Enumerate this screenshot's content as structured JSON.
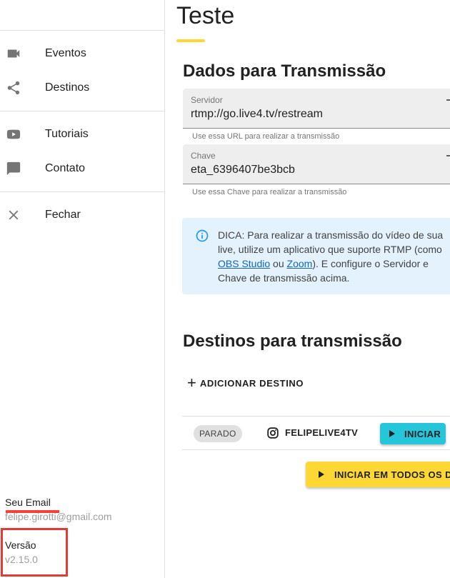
{
  "sidebar": {
    "items": [
      {
        "label": "Eventos",
        "icon": "videocam-icon"
      },
      {
        "label": "Destinos",
        "icon": "share-icon"
      },
      {
        "label": "Tutoriais",
        "icon": "youtube-icon"
      },
      {
        "label": "Contato",
        "icon": "chat-bubble-icon"
      },
      {
        "label": "Fechar",
        "icon": "close-icon"
      }
    ],
    "account": {
      "email_label": "Seu Email",
      "email_value": "felipe.girotti@gmail.com",
      "version_label": "Versão",
      "version_value": "v2.15.0"
    }
  },
  "main": {
    "title": "Teste",
    "stream_section_title": "Dados para Transmissão",
    "server_field": {
      "label": "Servidor",
      "value": "rtmp://go.live4.tv/restream",
      "hint": "Use essa URL para realizar a transmissão"
    },
    "key_field": {
      "label": "Chave",
      "value": "eta_6396407be3bcb",
      "hint": "Use essa Chave para realizar a transmissão"
    },
    "tip": {
      "text_before": "DICA: Para realizar a transmissão do vídeo de sua live, utilize um aplicativo que suporte RTMP (como ",
      "link1": "OBS Studio",
      "text_between": " ou ",
      "link2": "Zoom",
      "text_after": "). E configure o Servidor e Chave de transmissão acima."
    },
    "destinations_section_title": "Destinos para transmissão",
    "add_destination_label": "ADICIONAR DESTINO",
    "destinations": [
      {
        "status": "PARADO",
        "platform_icon": "instagram-icon",
        "name": "FELIPELIVE4TV",
        "start_label": "INICIAR"
      }
    ],
    "start_all_label": "INICIAR EM TODOS OS DESTINOS"
  },
  "colors": {
    "accent_yellow": "#fdd835",
    "start_button": "#26c6da",
    "tip_background": "#e3f2fd",
    "annotation_red": "#e53935"
  }
}
